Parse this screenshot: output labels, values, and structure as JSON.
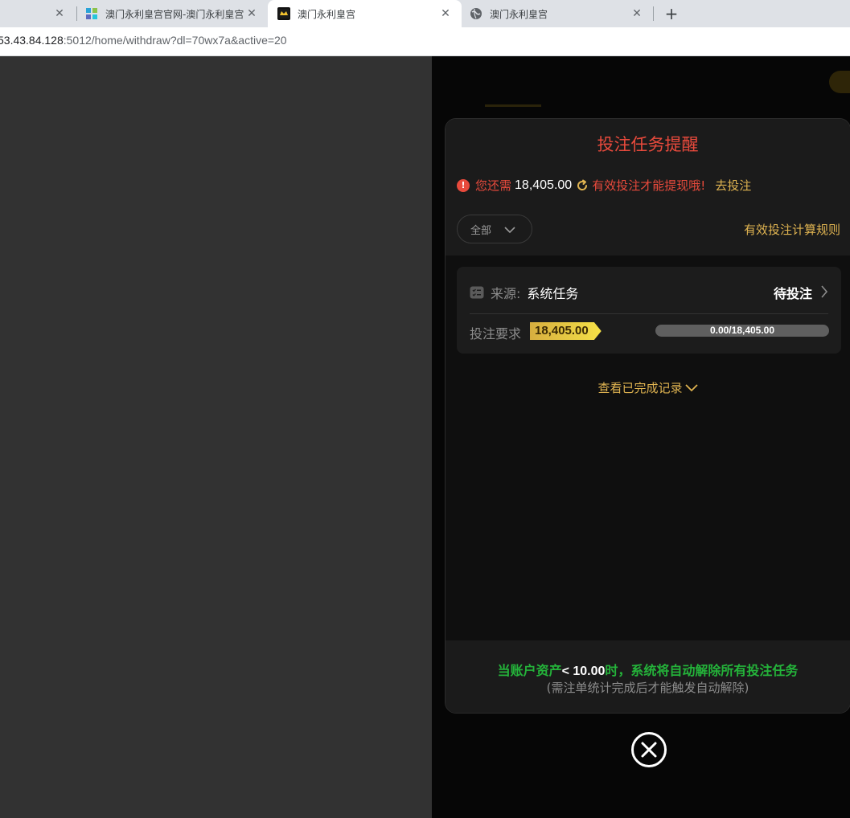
{
  "browser": {
    "tabs": [
      {
        "title": ""
      },
      {
        "title": "澳门永利皇宫官网-澳门永利皇宫"
      },
      {
        "title": "澳门永利皇宫"
      },
      {
        "title": "澳门永利皇宫"
      }
    ],
    "close_glyph": "✕",
    "new_tab_glyph": "+",
    "url_host": "53.43.84.128",
    "url_rest": ":5012/home/withdraw?dl=70wx7a&active=20"
  },
  "modal": {
    "title": "投注任务提醒",
    "notice": {
      "prefix": "您还需",
      "amount": "18,405.00",
      "suffix": "有效投注才能提现哦!",
      "action": "去投注"
    },
    "filter_label": "全部",
    "rules_link": "有效投注计算规则",
    "task": {
      "source_label": "来源:",
      "source_value": "系统任务",
      "status": "待投注",
      "requirement_label": "投注要求",
      "requirement_value": "18,405.00",
      "progress_text": "0.00/18,405.00",
      "progress_fraction": 0
    },
    "view_completed": "查看已完成记录",
    "footer": {
      "line1_prefix": "当账户资产",
      "line1_value": "< 10.00",
      "line1_suffix": "时，系统将自动解除所有投注任务",
      "line2": "(需注单统计完成后才能触发自动解除)"
    }
  },
  "colors": {
    "accent_gold": "#e0b451",
    "alert_red": "#e84a3c",
    "success_green": "#24b33a"
  },
  "icons": [
    "close-icon",
    "warning-icon",
    "refresh-icon",
    "chevron-down-icon",
    "task-list-icon",
    "chevron-right-icon",
    "globe-icon",
    "plus-icon"
  ]
}
